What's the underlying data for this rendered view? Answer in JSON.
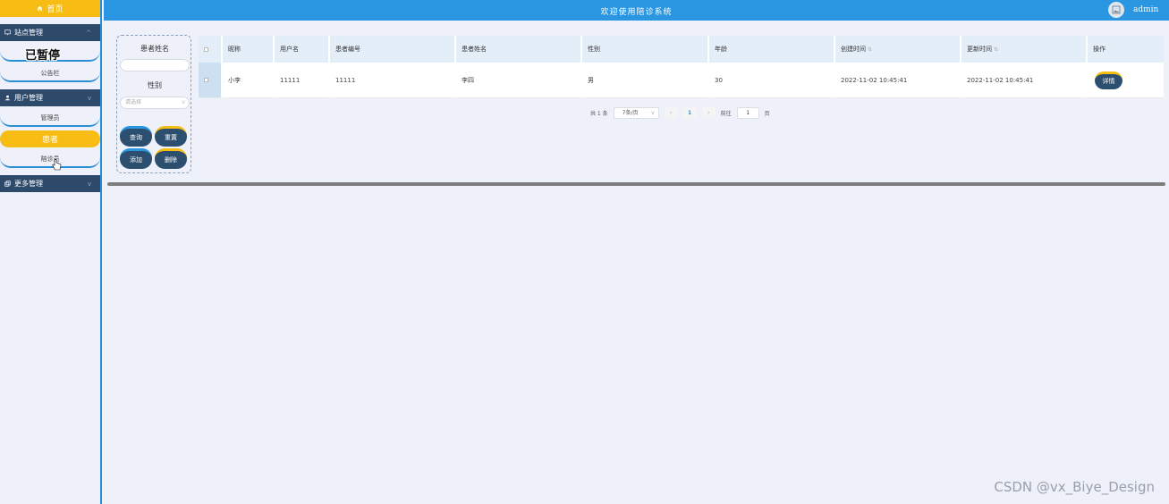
{
  "sidebar": {
    "home_label": "首页",
    "sections": [
      {
        "label": "站点管理",
        "items": [
          {
            "label": "已暂停"
          },
          {
            "label": "公告栏"
          }
        ]
      },
      {
        "label": "用户管理",
        "items": [
          {
            "label": "管理员"
          },
          {
            "label": "患者"
          },
          {
            "label": "陪诊员"
          }
        ]
      },
      {
        "label": "更多管理"
      }
    ]
  },
  "header": {
    "title": "欢迎使用陪诊系统",
    "username": "admin"
  },
  "search": {
    "name_label": "患者姓名",
    "gender_label": "性别",
    "gender_placeholder": "请选择",
    "buttons": {
      "query": "查询",
      "reset": "重置",
      "add": "添加",
      "delete": "删除"
    }
  },
  "table": {
    "columns": [
      "昵称",
      "用户名",
      "患者编号",
      "患者姓名",
      "性别",
      "年龄",
      "创建时间",
      "更新时间",
      "操作"
    ],
    "rows": [
      {
        "nickname": "小李",
        "username": "11111",
        "patient_no": "11111",
        "patient_name": "李四",
        "gender": "男",
        "age": "30",
        "created": "2022-11-02 10:45:41",
        "updated": "2022-11-02 10:45:41",
        "action": "详情"
      }
    ]
  },
  "pager": {
    "total": "共 1 条",
    "page_size": "7条/页",
    "prev": "‹",
    "page": "1",
    "next": "›",
    "goto": "前往",
    "goto_value": "1",
    "page_suffix": "页"
  },
  "watermark": "CSDN @vx_Biye_Design",
  "colors": {
    "accent_blue": "#2a95e0",
    "accent_gold": "#f7bd15",
    "navy": "#2e4a6b"
  }
}
